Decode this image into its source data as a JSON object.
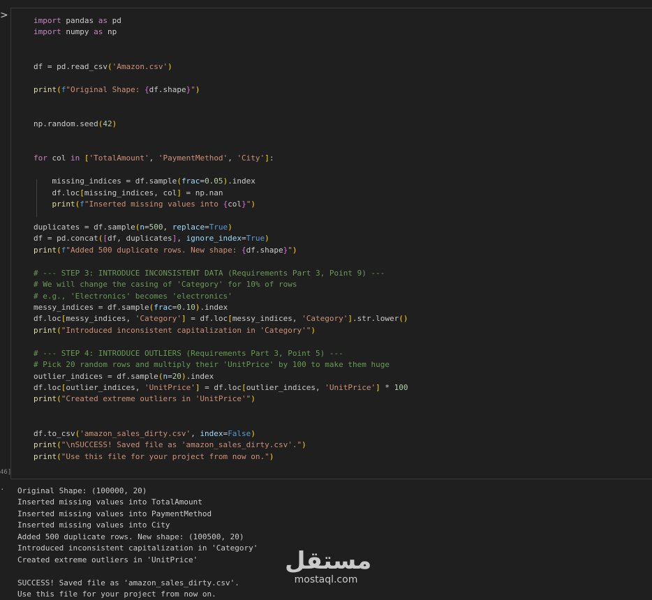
{
  "cell": {
    "run_glyph": ">",
    "execution_count": "46]",
    "output_marker": "·",
    "code_lines": [
      [
        [
          "kw",
          "import"
        ],
        [
          "t",
          " pandas "
        ],
        [
          "kw",
          "as"
        ],
        [
          "t",
          " pd"
        ]
      ],
      [
        [
          "kw",
          "import"
        ],
        [
          "t",
          " numpy "
        ],
        [
          "kw",
          "as"
        ],
        [
          "t",
          " np"
        ]
      ],
      [],
      [],
      [
        [
          "t",
          "df = pd.read_csv"
        ],
        [
          "br1",
          "("
        ],
        [
          "str",
          "'Amazon.csv'"
        ],
        [
          "br1",
          ")"
        ]
      ],
      [],
      [
        [
          "fn",
          "print"
        ],
        [
          "br1",
          "("
        ],
        [
          "kw2",
          "f"
        ],
        [
          "str",
          "\"Original Shape: "
        ],
        [
          "br2",
          "{"
        ],
        [
          "t",
          "df.shape"
        ],
        [
          "br2",
          "}"
        ],
        [
          "str",
          "\""
        ],
        [
          "br1",
          ")"
        ]
      ],
      [],
      [],
      [
        [
          "t",
          "np.random.seed"
        ],
        [
          "br1",
          "("
        ],
        [
          "num",
          "42"
        ],
        [
          "br1",
          ")"
        ]
      ],
      [],
      [],
      [
        [
          "kw",
          "for"
        ],
        [
          "t",
          " col "
        ],
        [
          "kw",
          "in"
        ],
        [
          "t",
          " "
        ],
        [
          "br1",
          "["
        ],
        [
          "str",
          "'TotalAmount'"
        ],
        [
          "t",
          ", "
        ],
        [
          "str",
          "'PaymentMethod'"
        ],
        [
          "t",
          ", "
        ],
        [
          "str",
          "'City'"
        ],
        [
          "br1",
          "]"
        ],
        [
          "t",
          ":"
        ]
      ],
      [],
      [
        [
          "t",
          "    missing_indices = df.sample"
        ],
        [
          "br1",
          "("
        ],
        [
          "var",
          "frac"
        ],
        [
          "t",
          "="
        ],
        [
          "num",
          "0.05"
        ],
        [
          "br1",
          ")"
        ],
        [
          "t",
          ".index"
        ]
      ],
      [
        [
          "t",
          "    df.loc"
        ],
        [
          "br1",
          "["
        ],
        [
          "t",
          "missing_indices, col"
        ],
        [
          "br1",
          "]"
        ],
        [
          "t",
          " = np.nan"
        ]
      ],
      [
        [
          "t",
          "    "
        ],
        [
          "fn",
          "print"
        ],
        [
          "br1",
          "("
        ],
        [
          "kw2",
          "f"
        ],
        [
          "str",
          "\"Inserted missing values into "
        ],
        [
          "br2",
          "{"
        ],
        [
          "t",
          "col"
        ],
        [
          "br2",
          "}"
        ],
        [
          "str",
          "\""
        ],
        [
          "br1",
          ")"
        ]
      ],
      [],
      [
        [
          "t",
          "duplicates = df.sample"
        ],
        [
          "br1",
          "("
        ],
        [
          "var",
          "n"
        ],
        [
          "t",
          "="
        ],
        [
          "num",
          "500"
        ],
        [
          "t",
          ", "
        ],
        [
          "var",
          "replace"
        ],
        [
          "t",
          "="
        ],
        [
          "kw2",
          "True"
        ],
        [
          "br1",
          ")"
        ]
      ],
      [
        [
          "t",
          "df = pd.concat"
        ],
        [
          "br1",
          "("
        ],
        [
          "br2",
          "["
        ],
        [
          "t",
          "df, duplicates"
        ],
        [
          "br2",
          "]"
        ],
        [
          "t",
          ", "
        ],
        [
          "var",
          "ignore_index"
        ],
        [
          "t",
          "="
        ],
        [
          "kw2",
          "True"
        ],
        [
          "br1",
          ")"
        ]
      ],
      [
        [
          "fn",
          "print"
        ],
        [
          "br1",
          "("
        ],
        [
          "kw2",
          "f"
        ],
        [
          "str",
          "\"Added 500 duplicate rows. New shape: "
        ],
        [
          "br2",
          "{"
        ],
        [
          "t",
          "df.shape"
        ],
        [
          "br2",
          "}"
        ],
        [
          "str",
          "\""
        ],
        [
          "br1",
          ")"
        ]
      ],
      [],
      [
        [
          "com",
          "# --- STEP 3: INTRODUCE INCONSISTENT DATA (Requirements Part 3, Point 9) ---"
        ]
      ],
      [
        [
          "com",
          "# We will change the casing of 'Category' for 10% of rows"
        ]
      ],
      [
        [
          "com",
          "# e.g., 'Electronics' becomes 'electronics'"
        ]
      ],
      [
        [
          "t",
          "messy_indices = df.sample"
        ],
        [
          "br1",
          "("
        ],
        [
          "var",
          "frac"
        ],
        [
          "t",
          "="
        ],
        [
          "num",
          "0.10"
        ],
        [
          "br1",
          ")"
        ],
        [
          "t",
          ".index"
        ]
      ],
      [
        [
          "t",
          "df.loc"
        ],
        [
          "br1",
          "["
        ],
        [
          "t",
          "messy_indices, "
        ],
        [
          "str",
          "'Category'"
        ],
        [
          "br1",
          "]"
        ],
        [
          "t",
          " = df.loc"
        ],
        [
          "br1",
          "["
        ],
        [
          "t",
          "messy_indices, "
        ],
        [
          "str",
          "'Category'"
        ],
        [
          "br1",
          "]"
        ],
        [
          "t",
          ".str.lower"
        ],
        [
          "br1",
          "()"
        ]
      ],
      [
        [
          "fn",
          "print"
        ],
        [
          "br1",
          "("
        ],
        [
          "str",
          "\"Introduced inconsistent capitalization in 'Category'\""
        ],
        [
          "br1",
          ")"
        ]
      ],
      [],
      [
        [
          "com",
          "# --- STEP 4: INTRODUCE OUTLIERS (Requirements Part 3, Point 5) ---"
        ]
      ],
      [
        [
          "com",
          "# Pick 20 random rows and multiply their 'UnitPrice' by 100 to make them huge"
        ]
      ],
      [
        [
          "t",
          "outlier_indices = df.sample"
        ],
        [
          "br1",
          "("
        ],
        [
          "var",
          "n"
        ],
        [
          "t",
          "="
        ],
        [
          "num",
          "20"
        ],
        [
          "br1",
          ")"
        ],
        [
          "t",
          ".index"
        ]
      ],
      [
        [
          "t",
          "df.loc"
        ],
        [
          "br1",
          "["
        ],
        [
          "t",
          "outlier_indices, "
        ],
        [
          "str",
          "'UnitPrice'"
        ],
        [
          "br1",
          "]"
        ],
        [
          "t",
          " = df.loc"
        ],
        [
          "br1",
          "["
        ],
        [
          "t",
          "outlier_indices, "
        ],
        [
          "str",
          "'UnitPrice'"
        ],
        [
          "br1",
          "]"
        ],
        [
          "t",
          " * "
        ],
        [
          "num",
          "100"
        ]
      ],
      [
        [
          "fn",
          "print"
        ],
        [
          "br1",
          "("
        ],
        [
          "str",
          "\"Created extreme outliers in 'UnitPrice'\""
        ],
        [
          "br1",
          ")"
        ]
      ],
      [],
      [],
      [
        [
          "t",
          "df.to_csv"
        ],
        [
          "br1",
          "("
        ],
        [
          "str",
          "'amazon_sales_dirty.csv'"
        ],
        [
          "t",
          ", "
        ],
        [
          "var",
          "index"
        ],
        [
          "t",
          "="
        ],
        [
          "kw2",
          "False"
        ],
        [
          "br1",
          ")"
        ]
      ],
      [
        [
          "fn",
          "print"
        ],
        [
          "br1",
          "("
        ],
        [
          "str",
          "\"\\nSUCCESS! Saved file as 'amazon_sales_dirty.csv'.\""
        ],
        [
          "br1",
          ")"
        ]
      ],
      [
        [
          "fn",
          "print"
        ],
        [
          "br1",
          "("
        ],
        [
          "str",
          "\"Use this file for your project from now on.\""
        ],
        [
          "br1",
          ")"
        ]
      ]
    ],
    "output_lines": [
      "Original Shape: (100000, 20)",
      "Inserted missing values into TotalAmount",
      "Inserted missing values into PaymentMethod",
      "Inserted missing values into City",
      "Added 500 duplicate rows. New shape: (100500, 20)",
      "Introduced inconsistent capitalization in 'Category'",
      "Created extreme outliers in 'UnitPrice'",
      "",
      "SUCCESS! Saved file as 'amazon_sales_dirty.csv'.",
      "Use this file for your project from now on."
    ]
  },
  "watermark": {
    "arabic": "مستقل",
    "latin": "mostaql.com"
  }
}
